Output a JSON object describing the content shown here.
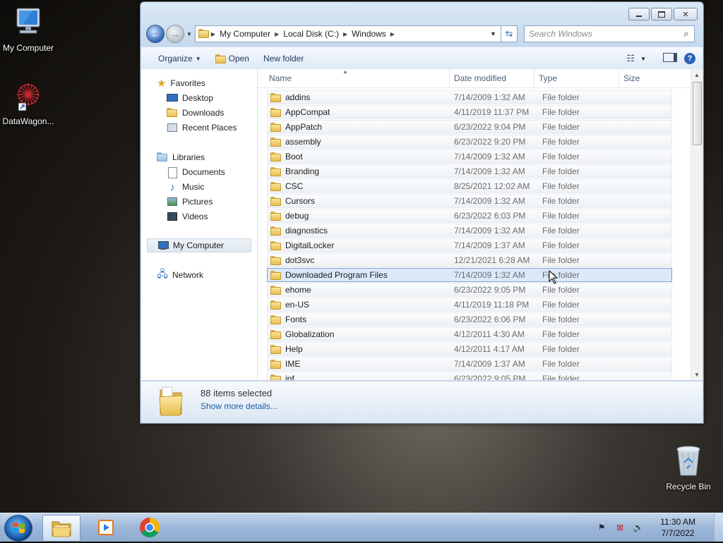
{
  "desktop": {
    "icons": [
      {
        "label": "My Computer"
      },
      {
        "label": "DataWagon..."
      },
      {
        "label": "Recycle Bin"
      }
    ]
  },
  "window": {
    "breadcrumb": [
      "My Computer",
      "Local Disk (C:)",
      "Windows"
    ],
    "search_placeholder": "Search Windows",
    "toolbar": {
      "organize": "Organize",
      "open": "Open",
      "new_folder": "New folder"
    },
    "nav": {
      "favorites": "Favorites",
      "favorites_items": [
        "Desktop",
        "Downloads",
        "Recent Places"
      ],
      "libraries": "Libraries",
      "libraries_items": [
        "Documents",
        "Music",
        "Pictures",
        "Videos"
      ],
      "computer": "My Computer",
      "network": "Network"
    },
    "columns": {
      "name": "Name",
      "date": "Date modified",
      "type": "Type",
      "size": "Size"
    },
    "files": [
      {
        "name": "addins",
        "date": "7/14/2009 1:32 AM",
        "type": "File folder"
      },
      {
        "name": "AppCompat",
        "date": "4/11/2019 11:37 PM",
        "type": "File folder"
      },
      {
        "name": "AppPatch",
        "date": "6/23/2022 9:04 PM",
        "type": "File folder"
      },
      {
        "name": "assembly",
        "date": "6/23/2022 9:20 PM",
        "type": "File folder"
      },
      {
        "name": "Boot",
        "date": "7/14/2009 1:32 AM",
        "type": "File folder"
      },
      {
        "name": "Branding",
        "date": "7/14/2009 1:32 AM",
        "type": "File folder"
      },
      {
        "name": "CSC",
        "date": "8/25/2021 12:02 AM",
        "type": "File folder"
      },
      {
        "name": "Cursors",
        "date": "7/14/2009 1:32 AM",
        "type": "File folder"
      },
      {
        "name": "debug",
        "date": "6/23/2022 6:03 PM",
        "type": "File folder"
      },
      {
        "name": "diagnostics",
        "date": "7/14/2009 1:32 AM",
        "type": "File folder"
      },
      {
        "name": "DigitalLocker",
        "date": "7/14/2009 1:37 AM",
        "type": "File folder"
      },
      {
        "name": "dot3svc",
        "date": "12/21/2021 6:28 AM",
        "type": "File folder"
      },
      {
        "name": "Downloaded Program Files",
        "date": "7/14/2009 1:32 AM",
        "type": "File folder"
      },
      {
        "name": "ehome",
        "date": "6/23/2022 9:05 PM",
        "type": "File folder"
      },
      {
        "name": "en-US",
        "date": "4/11/2019 11:18 PM",
        "type": "File folder"
      },
      {
        "name": "Fonts",
        "date": "6/23/2022 6:06 PM",
        "type": "File folder"
      },
      {
        "name": "Globalization",
        "date": "4/12/2011 4:30 AM",
        "type": "File folder"
      },
      {
        "name": "Help",
        "date": "4/12/2011 4:17 AM",
        "type": "File folder"
      },
      {
        "name": "IME",
        "date": "7/14/2009 1:37 AM",
        "type": "File folder"
      },
      {
        "name": "inf",
        "date": "6/23/2022 9:05 PM",
        "type": "File folder"
      }
    ],
    "selected_index": 12,
    "details": {
      "count": "88 items selected",
      "more": "Show more details..."
    }
  },
  "taskbar": {
    "time": "11:30 AM",
    "date": "7/7/2022"
  }
}
